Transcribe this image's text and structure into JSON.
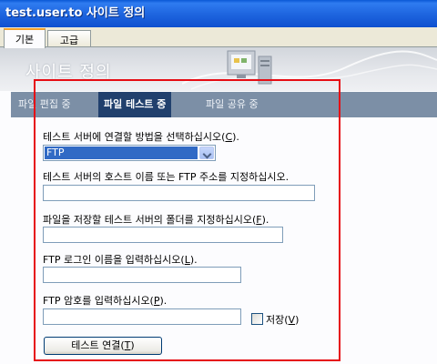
{
  "window": {
    "title": "test.user.to 사이트 정의"
  },
  "tabs": [
    {
      "label": "기본",
      "active": true
    },
    {
      "label": "고급",
      "active": false
    }
  ],
  "banner": {
    "title": "사이트 정의"
  },
  "steps": [
    {
      "label": "파일 편집 중",
      "active": false
    },
    {
      "label": "파일 테스트 중",
      "active": true
    },
    {
      "label": "파일 공유 중",
      "active": false
    }
  ],
  "form": {
    "connect_label_pre": "테스트 서버에 연결할 방법을 선택하십시오(",
    "connect_label_key": "C",
    "connect_label_post": ").",
    "connect_value": "FTP",
    "host_label": "테스트 서버의 호스트 이름 또는 FTP 주소를 지정하십시오.",
    "host_value": "",
    "folder_label_pre": "파일을 저장할 테스트 서버의 폴더를 지정하십시오(",
    "folder_label_key": "F",
    "folder_label_post": ").",
    "folder_value": "",
    "login_label_pre": "FTP 로그인 이름을 입력하십시오(",
    "login_label_key": "L",
    "login_label_post": ").",
    "login_value": "",
    "password_label_pre": "FTP 암호를 입력하십시오(",
    "password_label_key": "P",
    "password_label_post": ").",
    "password_value": "",
    "save_pre": "저장(",
    "save_key": "V",
    "save_post": ")",
    "save_checked": false,
    "test_pre": "테스트 연결(",
    "test_key": "T",
    "test_post": ")"
  },
  "colors": {
    "highlight_frame": "#e60d14",
    "step_bar": "#7c8fa6",
    "step_active": "#21406d",
    "title_bar": "#1f66e0"
  },
  "icons": [
    "site-server-icon",
    "chevron-down-icon"
  ]
}
